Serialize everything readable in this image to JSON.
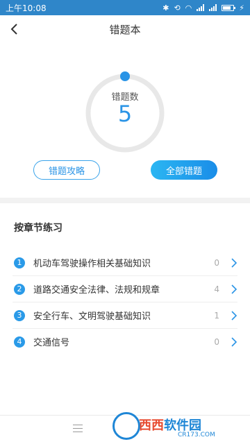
{
  "status_bar": {
    "time": "上午10:08",
    "icons": [
      "bluetooth-icon",
      "rotate-icon",
      "wifi-icon",
      "signal-icon",
      "signal-icon",
      "battery-icon",
      "charging-icon"
    ],
    "bg_color": "#2f86c9"
  },
  "header": {
    "title": "错题本",
    "back_icon": "chevron-left-icon"
  },
  "summary": {
    "label": "错题数",
    "count": "5",
    "accent_color": "#2a94e6"
  },
  "actions": {
    "strategy_label": "错题攻略",
    "all_wrong_label": "全部错题"
  },
  "section": {
    "title": "按章节练习"
  },
  "chapters": [
    {
      "index": "1",
      "label": "机动车驾驶操作相关基础知识",
      "count": "0"
    },
    {
      "index": "2",
      "label": "道路交通安全法律、法规和规章",
      "count": "4"
    },
    {
      "index": "3",
      "label": "安全行车、文明驾驶基础知识",
      "count": "1"
    },
    {
      "index": "4",
      "label": "交通信号",
      "count": "0"
    }
  ],
  "watermark": {
    "brand_red": "西西",
    "brand_blue": "软件园",
    "domain": "CR173.COM"
  }
}
